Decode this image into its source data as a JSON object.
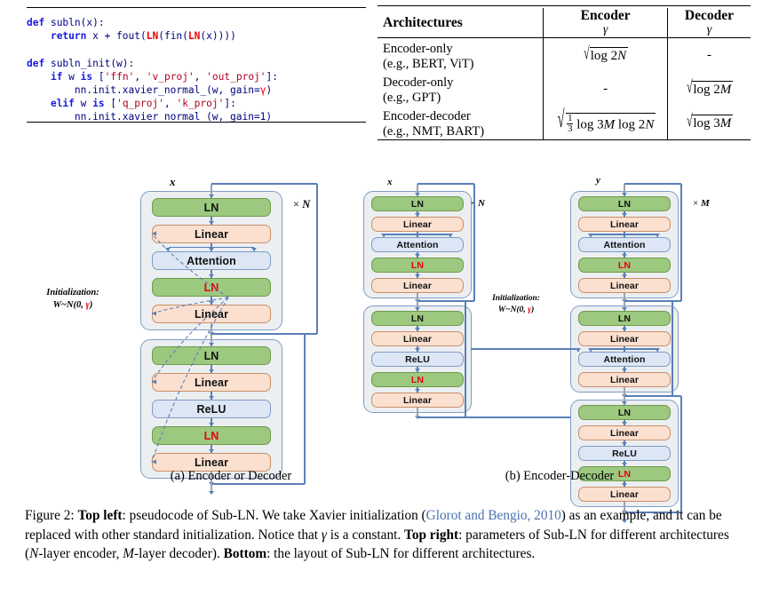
{
  "code_panel": {
    "lines": [
      [
        {
          "t": "def ",
          "c": "kw"
        },
        {
          "t": "subln",
          "c": "fn"
        },
        {
          "t": "(x):",
          "c": "pl"
        }
      ],
      [
        {
          "t": "    ",
          "c": "pl"
        },
        {
          "t": "return",
          "c": "kw"
        },
        {
          "t": " x + fout(",
          "c": "pl"
        },
        {
          "t": "LN",
          "c": "rd"
        },
        {
          "t": "(fin(",
          "c": "pl"
        },
        {
          "t": "LN",
          "c": "rd"
        },
        {
          "t": "(x))))",
          "c": "pl"
        }
      ],
      [
        {
          "t": " ",
          "c": "pl"
        }
      ],
      [
        {
          "t": "def ",
          "c": "kw"
        },
        {
          "t": "subln_init",
          "c": "fn"
        },
        {
          "t": "(w):",
          "c": "pl"
        }
      ],
      [
        {
          "t": "    ",
          "c": "pl"
        },
        {
          "t": "if",
          "c": "kw"
        },
        {
          "t": " w ",
          "c": "pl"
        },
        {
          "t": "is",
          "c": "kw"
        },
        {
          "t": " [",
          "c": "pl"
        },
        {
          "t": "'ffn'",
          "c": "st"
        },
        {
          "t": ", ",
          "c": "pl"
        },
        {
          "t": "'v_proj'",
          "c": "st"
        },
        {
          "t": ", ",
          "c": "pl"
        },
        {
          "t": "'out_proj'",
          "c": "st"
        },
        {
          "t": "]:",
          "c": "pl"
        }
      ],
      [
        {
          "t": "        nn.init.xavier_normal_(w, gain=",
          "c": "pl"
        },
        {
          "t": "γ",
          "c": "gm"
        },
        {
          "t": ")",
          "c": "pl"
        }
      ],
      [
        {
          "t": "    ",
          "c": "pl"
        },
        {
          "t": "elif",
          "c": "kw"
        },
        {
          "t": " w ",
          "c": "pl"
        },
        {
          "t": "is",
          "c": "kw"
        },
        {
          "t": " [",
          "c": "pl"
        },
        {
          "t": "'q_proj'",
          "c": "st"
        },
        {
          "t": ", ",
          "c": "pl"
        },
        {
          "t": "'k_proj'",
          "c": "st"
        },
        {
          "t": "]:",
          "c": "pl"
        }
      ],
      [
        {
          "t": "        nn.init.xavier_normal_(w, gain=1)",
          "c": "pl"
        }
      ]
    ]
  },
  "arch_table": {
    "headers": {
      "architectures": "Architectures",
      "encoder": "Encoder",
      "decoder": "Decoder",
      "gamma": "γ"
    },
    "rows": [
      {
        "name": "Encoder-only",
        "example": "(e.g., BERT, ViT)",
        "encoder": "√(log 2N)",
        "decoder": "-"
      },
      {
        "name": "Decoder-only",
        "example": "(e.g., GPT)",
        "encoder": "-",
        "decoder": "√(log 2M)"
      },
      {
        "name": "Encoder-decoder",
        "example": "(e.g., NMT, BART)",
        "encoder": "√(1/3 log 3M log 2N)",
        "decoder": "√(log 3M)"
      }
    ]
  },
  "diagrams": {
    "colors": {
      "ln": "#9cc97f",
      "linear": "#fbe0d0",
      "activation": "#dce6f4",
      "group_bg": "#eceff1",
      "connector": "#5b7fb9",
      "red_text": "#e8000d"
    },
    "labels": {
      "ln": "LN",
      "linear": "Linear",
      "attention": "Attention",
      "relu": "ReLU",
      "input_x": "x",
      "input_y": "y",
      "times_n": "× N",
      "times_m": "× M",
      "init_line1": "Initialization:",
      "init_line2": "W~N(0, γ)"
    },
    "subcaptions": {
      "a": "(a) Encoder or Decoder",
      "b": "(b) Encoder-Decoder"
    },
    "panel_a": {
      "input": "x",
      "repeat": "× N",
      "blocks": [
        {
          "name": "attention-block",
          "rows": [
            {
              "label": "LN",
              "kind": "ln",
              "red": false
            },
            {
              "label": "Linear",
              "kind": "lin",
              "red": false
            },
            {
              "label": "Attention",
              "kind": "act",
              "red": false
            },
            {
              "label": "LN",
              "kind": "ln",
              "red": true
            },
            {
              "label": "Linear",
              "kind": "lin",
              "red": false
            }
          ]
        },
        {
          "name": "ffn-block",
          "rows": [
            {
              "label": "LN",
              "kind": "ln",
              "red": false
            },
            {
              "label": "Linear",
              "kind": "lin",
              "red": false
            },
            {
              "label": "ReLU",
              "kind": "act",
              "red": false
            },
            {
              "label": "LN",
              "kind": "ln",
              "red": true
            },
            {
              "label": "Linear",
              "kind": "lin",
              "red": false
            }
          ]
        }
      ]
    },
    "panel_b_encoder": {
      "input": "x",
      "repeat": "× N",
      "blocks": [
        {
          "name": "attention-block",
          "rows": [
            {
              "label": "LN",
              "kind": "ln",
              "red": false
            },
            {
              "label": "Linear",
              "kind": "lin",
              "red": false
            },
            {
              "label": "Attention",
              "kind": "act",
              "red": false
            },
            {
              "label": "LN",
              "kind": "ln",
              "red": true
            },
            {
              "label": "Linear",
              "kind": "lin",
              "red": false
            }
          ]
        },
        {
          "name": "ffn-block",
          "rows": [
            {
              "label": "LN",
              "kind": "ln",
              "red": false
            },
            {
              "label": "Linear",
              "kind": "lin",
              "red": false
            },
            {
              "label": "ReLU",
              "kind": "act",
              "red": false
            },
            {
              "label": "LN",
              "kind": "ln",
              "red": true
            },
            {
              "label": "Linear",
              "kind": "lin",
              "red": false
            }
          ]
        }
      ]
    },
    "panel_b_decoder": {
      "input": "y",
      "repeat": "× M",
      "blocks": [
        {
          "name": "self-attention-block",
          "rows": [
            {
              "label": "LN",
              "kind": "ln",
              "red": false
            },
            {
              "label": "Linear",
              "kind": "lin",
              "red": false
            },
            {
              "label": "Attention",
              "kind": "act",
              "red": false
            },
            {
              "label": "LN",
              "kind": "ln",
              "red": true
            },
            {
              "label": "Linear",
              "kind": "lin",
              "red": false
            }
          ]
        },
        {
          "name": "cross-attention-block",
          "rows": [
            {
              "label": "LN",
              "kind": "ln",
              "red": false
            },
            {
              "label": "Linear",
              "kind": "lin",
              "red": false
            },
            {
              "label": "Attention",
              "kind": "act",
              "red": false
            },
            {
              "label": "Linear",
              "kind": "lin",
              "red": false
            }
          ]
        },
        {
          "name": "ffn-block",
          "rows": [
            {
              "label": "LN",
              "kind": "ln",
              "red": false
            },
            {
              "label": "Linear",
              "kind": "lin",
              "red": false
            },
            {
              "label": "ReLU",
              "kind": "act",
              "red": false
            },
            {
              "label": "LN",
              "kind": "ln",
              "red": true
            },
            {
              "label": "Linear",
              "kind": "lin",
              "red": false
            }
          ]
        }
      ]
    }
  },
  "caption": {
    "figure_label": "Figure 2:",
    "bold1": "Top left",
    "text1": ": pseudocode of Sub-LN. We take Xavier initialization (",
    "cite": "Glorot and Bengio, 2010",
    "text2": ") as an example, and it can be replaced with other standard initialization. Notice that γ is a constant. ",
    "bold2": "Top right",
    "text3": ": parameters of Sub-LN for different architectures (N-layer encoder, M-layer decoder). ",
    "bold3": "Bottom",
    "text4": ": the layout of Sub-LN for different architectures."
  }
}
